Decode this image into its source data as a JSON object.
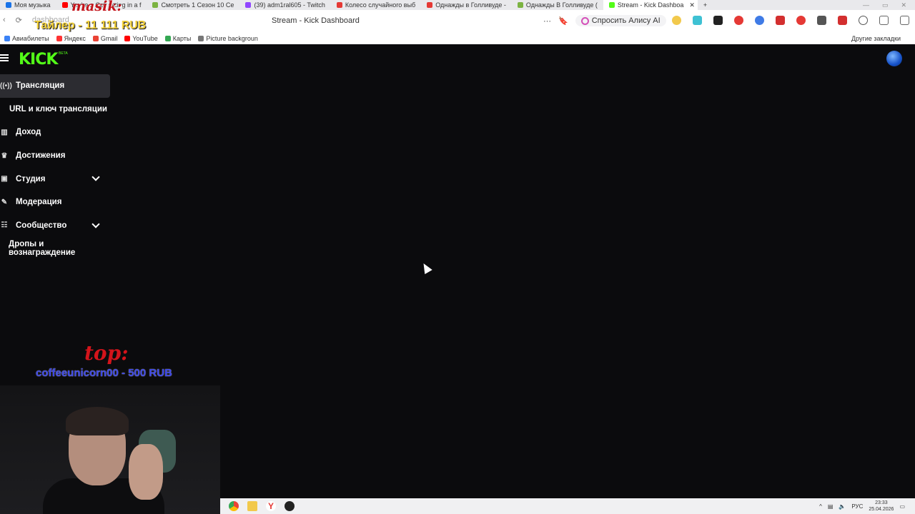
{
  "browser": {
    "tabs": [
      {
        "label": "Моя музыка",
        "color": "#1a73e8"
      },
      {
        "label": "You're a Celt sitting in a f",
        "color": "#ff0000"
      },
      {
        "label": "Смотреть 1 Сезон 10 Се",
        "color": "#7cb342"
      },
      {
        "label": "(39) adm1ral605 - Twitch",
        "color": "#9146ff"
      },
      {
        "label": "Колесо случайного выб",
        "color": "#e53935"
      },
      {
        "label": "Однажды в Голливуде -",
        "color": "#e53935"
      },
      {
        "label": "Однажды В Голливуде (",
        "color": "#7cb342"
      },
      {
        "label": "Stream - Kick Dashboa",
        "color": "#53fc18",
        "active": true
      }
    ],
    "page_title": "Stream - Kick Dashboard",
    "address_hint": "dashboard",
    "alice_label": "Спросить Алису AI",
    "bookmarks": [
      {
        "label": "Авиабилеты",
        "color": "#3b82f6"
      },
      {
        "label": "Яндекс",
        "color": "#ff3333"
      },
      {
        "label": "Gmail",
        "color": "#ea4335"
      },
      {
        "label": "YouTube",
        "color": "#ff0000"
      },
      {
        "label": "Карты",
        "color": "#34a853"
      },
      {
        "label": "Picture backgroun",
        "color": "#777777"
      }
    ],
    "other_bookmarks": "Другие закладки"
  },
  "overlay": {
    "tag": "masik:",
    "tailer": "Тайлер - 11 111 RUB",
    "top_label": "top:",
    "donor": "coffeeunicorn00 - 500 RUB"
  },
  "kick": {
    "logo": "KICK",
    "beta": "BETA",
    "accent": "#53fc18",
    "nav": [
      {
        "label": "Трансляция",
        "icon": "broadcast-icon",
        "glyph": "((•))",
        "active": true
      },
      {
        "label": "URL и ключ трансляции",
        "icon": "",
        "glyph": ""
      },
      {
        "label": "Доход",
        "icon": "chart-icon",
        "glyph": "▥"
      },
      {
        "label": "Достижения",
        "icon": "trophy-icon",
        "glyph": "🏆"
      },
      {
        "label": "Студия",
        "icon": "studio-icon",
        "glyph": "▶",
        "expandable": true
      },
      {
        "label": "Модерация",
        "icon": "wrench-icon",
        "glyph": "🔧"
      },
      {
        "label": "Сообщество",
        "icon": "community-icon",
        "glyph": "👥",
        "expandable": true
      },
      {
        "label": "Дропы и вознаграждение",
        "icon": "",
        "glyph": ""
      }
    ]
  },
  "taskbar": {
    "lang": "РУС",
    "time": "23:33",
    "date": "25.04.2026"
  }
}
